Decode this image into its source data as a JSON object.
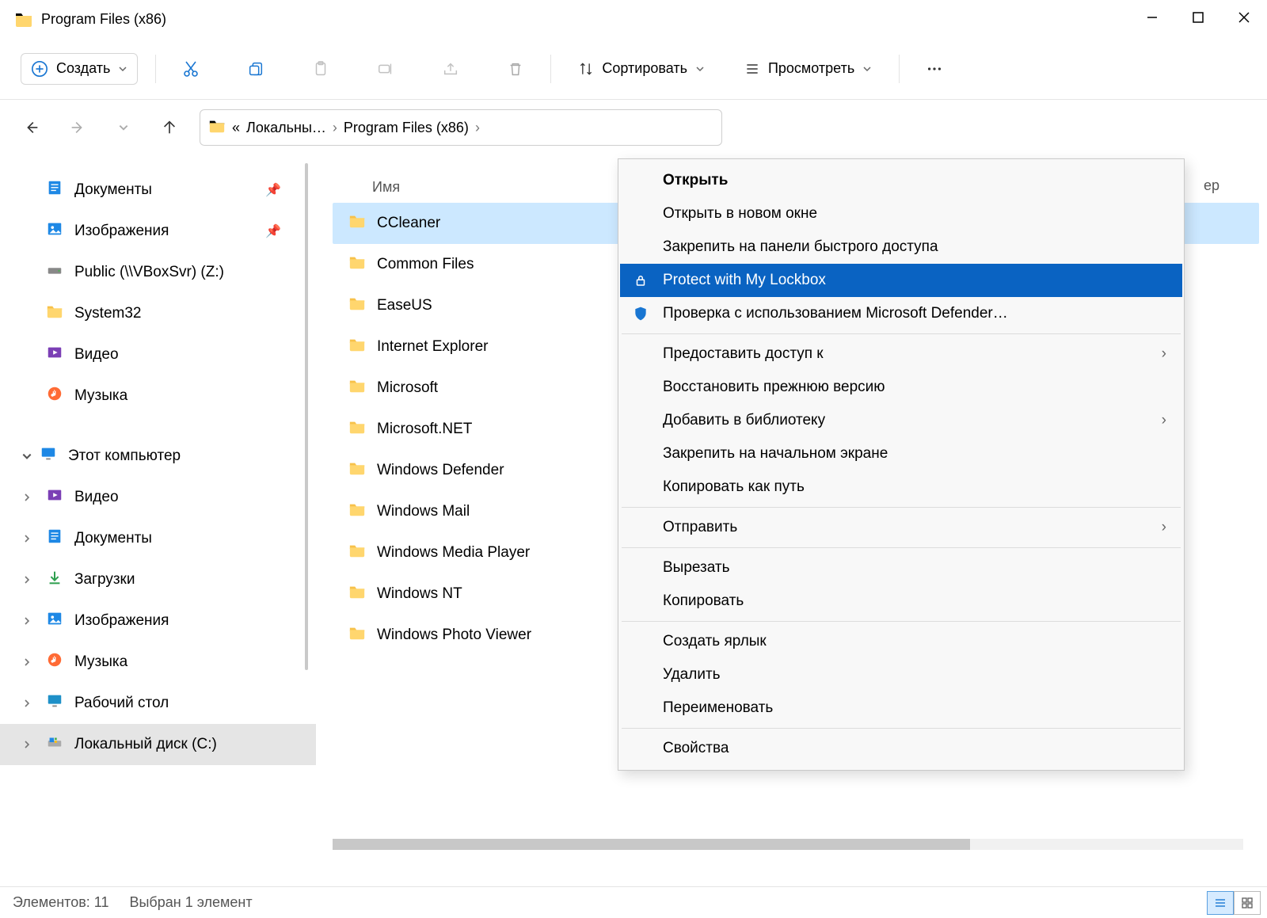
{
  "window": {
    "title": "Program Files (x86)"
  },
  "toolbar": {
    "create": "Создать",
    "sort": "Сортировать",
    "view": "Просмотреть"
  },
  "breadcrumbs": {
    "prefix": "«",
    "items": [
      "Локальны…",
      "Program Files (x86)"
    ]
  },
  "sidebar": {
    "quick": [
      {
        "label": "Документы",
        "icon": "doc"
      },
      {
        "label": "Изображения",
        "icon": "img"
      },
      {
        "label": "Public (\\\\VBoxSvr) (Z:)",
        "icon": "drive"
      },
      {
        "label": "System32",
        "icon": "folder"
      },
      {
        "label": "Видео",
        "icon": "video"
      },
      {
        "label": "Музыка",
        "icon": "music"
      }
    ],
    "pc_label": "Этот компьютер",
    "pc_children": [
      {
        "label": "Видео",
        "icon": "video"
      },
      {
        "label": "Документы",
        "icon": "doc"
      },
      {
        "label": "Загрузки",
        "icon": "download"
      },
      {
        "label": "Изображения",
        "icon": "img"
      },
      {
        "label": "Музыка",
        "icon": "music"
      },
      {
        "label": "Рабочий стол",
        "icon": "desktop"
      },
      {
        "label": "Локальный диск (C:)",
        "icon": "osdrive"
      }
    ]
  },
  "columns": {
    "name": "Имя",
    "other": "ер"
  },
  "files": [
    "CCleaner",
    "Common Files",
    "EaseUS",
    "Internet Explorer",
    "Microsoft",
    "Microsoft.NET",
    "Windows Defender",
    "Windows Mail",
    "Windows Media Player",
    "Windows NT",
    "Windows Photo Viewer"
  ],
  "context_menu": {
    "items": [
      {
        "label": "Открыть",
        "bold": true
      },
      {
        "label": "Открыть в новом окне"
      },
      {
        "label": "Закрепить на панели быстрого доступа"
      },
      {
        "label": "Protect with My Lockbox",
        "highlighted": true,
        "icon": "lock"
      },
      {
        "label": "Проверка с использованием Microsoft Defender…",
        "icon": "shield"
      },
      {
        "sep": true
      },
      {
        "label": "Предоставить доступ к",
        "submenu": true
      },
      {
        "label": "Восстановить прежнюю версию"
      },
      {
        "label": "Добавить в библиотеку",
        "submenu": true
      },
      {
        "label": "Закрепить на начальном экране"
      },
      {
        "label": "Копировать как путь"
      },
      {
        "sep": true
      },
      {
        "label": "Отправить",
        "submenu": true
      },
      {
        "sep": true
      },
      {
        "label": "Вырезать"
      },
      {
        "label": "Копировать"
      },
      {
        "sep": true
      },
      {
        "label": "Создать ярлык"
      },
      {
        "label": "Удалить"
      },
      {
        "label": "Переименовать"
      },
      {
        "sep": true
      },
      {
        "label": "Свойства"
      }
    ]
  },
  "status": {
    "count": "Элементов: 11",
    "selected": "Выбран 1 элемент"
  }
}
